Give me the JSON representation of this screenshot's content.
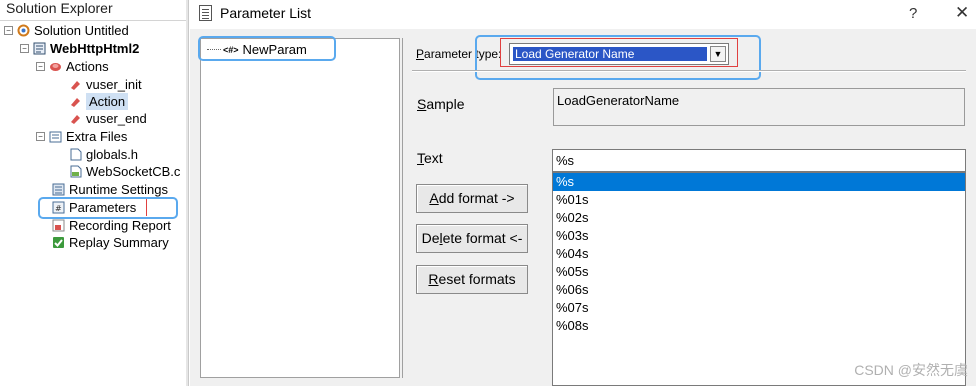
{
  "explorer": {
    "title": "Solution Explorer",
    "items": [
      {
        "label": "Solution Untitled",
        "icon": "solution-icon"
      },
      {
        "label": "WebHttpHtml2",
        "icon": "script-icon"
      },
      {
        "label": "Actions",
        "icon": "actions-icon"
      },
      {
        "label": "vuser_init",
        "icon": "action-icon"
      },
      {
        "label": "Action",
        "icon": "action-icon"
      },
      {
        "label": "vuser_end",
        "icon": "action-icon"
      },
      {
        "label": "Extra Files",
        "icon": "folder-icon"
      },
      {
        "label": "globals.h",
        "icon": "file-icon"
      },
      {
        "label": "WebSocketCB.c",
        "icon": "c-file-icon"
      },
      {
        "label": "Runtime Settings",
        "icon": "settings-icon"
      },
      {
        "label": "Parameters",
        "icon": "parameters-icon"
      },
      {
        "label": "Recording Report",
        "icon": "report-icon"
      },
      {
        "label": "Replay Summary",
        "icon": "check-icon"
      }
    ]
  },
  "dialog": {
    "title": "Parameter List",
    "help": "?",
    "close": "✕",
    "param_item": {
      "tag": "<#>",
      "label": "NewParam"
    },
    "parameter_type": {
      "label_prefix": "P",
      "label_rest": "arameter type:",
      "value": "Load Generator Name"
    },
    "sample": {
      "label_u": "S",
      "label_rest": "ample",
      "value": "LoadGeneratorName"
    },
    "text": {
      "label_u": "T",
      "label_rest": "ext",
      "value": "%s"
    },
    "buttons": {
      "add": {
        "u": "A",
        "rest": "dd format ->"
      },
      "delete": {
        "pre": "De",
        "u": "l",
        "rest": "ete format <-"
      },
      "reset": {
        "u": "R",
        "rest": "eset formats"
      }
    },
    "formats": [
      "%s",
      "%01s",
      "%02s",
      "%03s",
      "%04s",
      "%05s",
      "%06s",
      "%07s",
      "%08s"
    ],
    "selected_format": "%s"
  },
  "watermark": "CSDN @安然无虞",
  "colors": {
    "highlight": "#5aa9ee",
    "selection": "#0078d7",
    "red_frame": "#e04040"
  }
}
